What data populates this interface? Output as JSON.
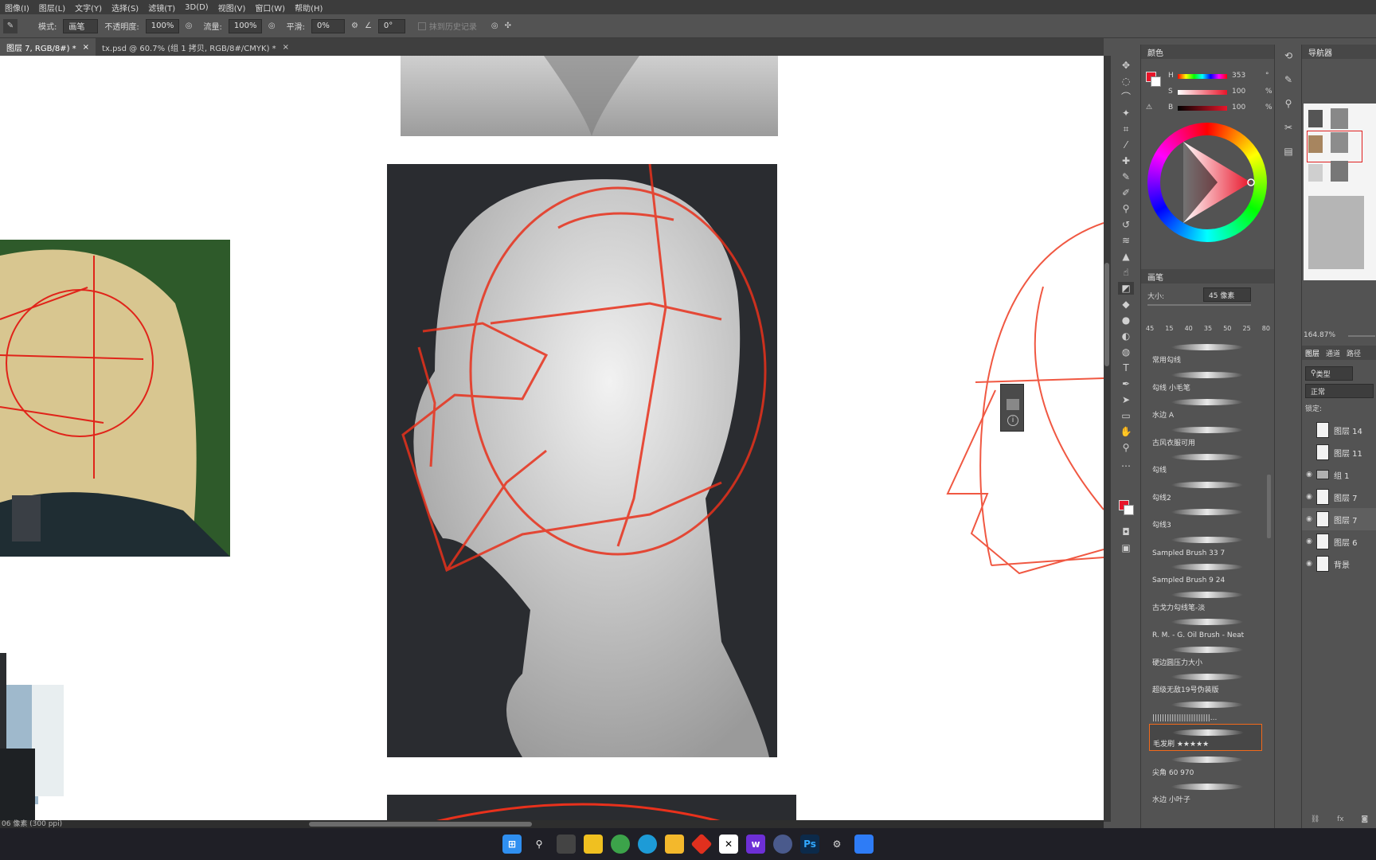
{
  "menu": [
    "图像(I)",
    "图层(L)",
    "文字(Y)",
    "选择(S)",
    "滤镜(T)",
    "3D(D)",
    "视图(V)",
    "窗口(W)",
    "帮助(H)"
  ],
  "options": {
    "mode_label": "模式:",
    "mode_value": "画笔",
    "opacity_label": "不透明度:",
    "opacity_value": "100%",
    "flow_label": "流量:",
    "flow_value": "100%",
    "smooth_label": "平滑:",
    "smooth_value": "0%",
    "angle_value": "0°",
    "history_label": "抹到历史记录"
  },
  "tabs": [
    {
      "label": "图层 7, RGB/8#) *",
      "active": true
    },
    {
      "label": "tx.psd @ 60.7% (组 1 拷贝, RGB/8#/CMYK) *",
      "active": false
    }
  ],
  "status": {
    "doc_info": "06 像素 (300 ppi)"
  },
  "color_panel": {
    "title": "颜色",
    "h_label": "H",
    "h_value": "353",
    "h_unit": "°",
    "s_label": "S",
    "s_value": "100",
    "s_unit": "%",
    "b_label": "B",
    "b_value": "100",
    "b_unit": "%",
    "foreground": "#e8152a"
  },
  "brush_panel": {
    "title": "画笔",
    "size_label": "大小:",
    "size_value": "45 像素",
    "presets": [
      "45",
      "15",
      "40",
      "35",
      "50",
      "25",
      "80"
    ],
    "brushes": [
      "常用勾线",
      "勾线 小毛笔",
      "水边 A",
      "古风衣服可用",
      "勾线",
      "勾线2",
      "勾线3",
      "Sampled Brush 33 7",
      "Sampled Brush 9 24",
      "古戈力勾线笔-淡",
      "R. M. - G. Oil Brush - Neat",
      "硬边圆压力大小",
      "超级无敌19号伪装版",
      "||||||||||||||||||||||||...",
      "毛发刷 ★★★★★",
      "尖角 60 970",
      "水边 小叶子"
    ],
    "selected": "毛发刷 ★★★★★"
  },
  "navigator": {
    "title": "导航器",
    "zoom": "164.87%"
  },
  "layers_panel": {
    "tabs": [
      "图层",
      "通道",
      "路径"
    ],
    "filter": "类型",
    "blend": "正常",
    "lock_label": "锁定:",
    "layers": [
      "图层 14",
      "图层 11",
      "组 1",
      "图层 7",
      "图层 7",
      "图层 6",
      "背景"
    ]
  },
  "taskbar": {
    "ps_label": "Ps"
  }
}
